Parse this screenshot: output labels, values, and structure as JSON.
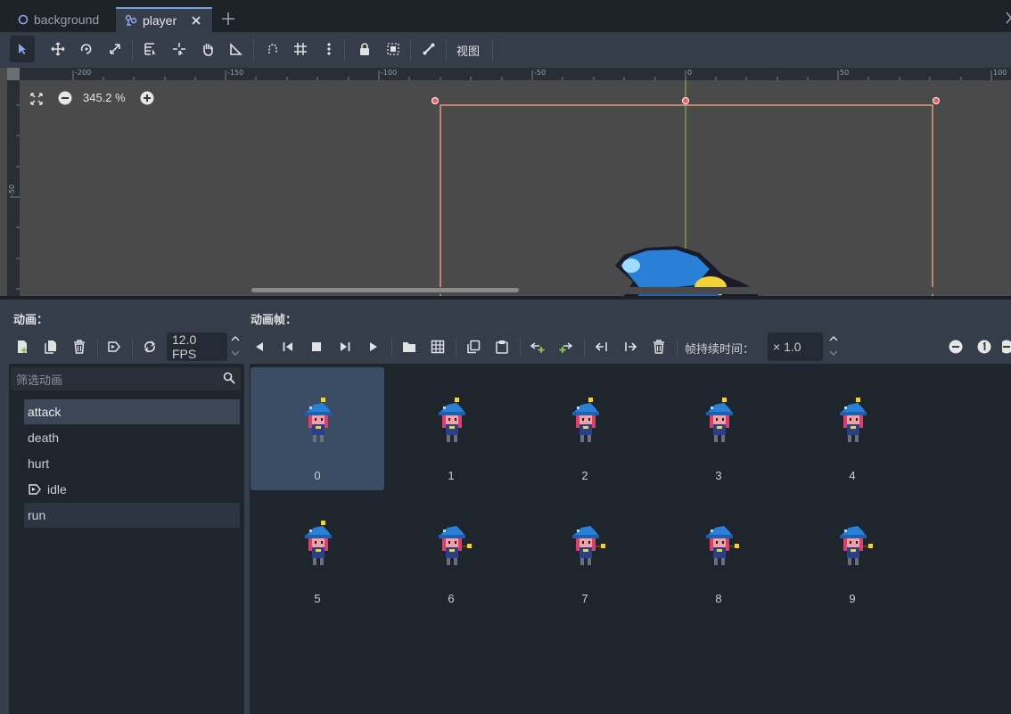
{
  "scene_tabs": [
    {
      "label": "background",
      "icon": "circle-node-icon",
      "active": false
    },
    {
      "label": "player",
      "icon": "scene-icon",
      "active": true,
      "close_icon": "close-icon"
    }
  ],
  "add_tab_icon": "plus-icon",
  "toolbar": {
    "tools": [
      "select-icon",
      "move-icon",
      "rotate-icon",
      "scale-icon",
      "list-select-icon",
      "pivot-icon",
      "pan-icon",
      "ruler-icon",
      "smart-snap-icon",
      "grid-snap-icon",
      "more-icon",
      "lock-icon",
      "group-icon",
      "bone-icon"
    ],
    "view_menu": "视图"
  },
  "viewport": {
    "zoom_label": "345.2 %",
    "ruler_h_labels": [
      "-200",
      "-150",
      "-100",
      "-50",
      "0",
      "50",
      "100"
    ],
    "ruler_v_labels": [
      "-50"
    ]
  },
  "animations_panel": {
    "title": "动画：",
    "filter_placeholder": "筛选动画",
    "items": [
      {
        "label": "attack",
        "selected": true
      },
      {
        "label": "death"
      },
      {
        "label": "hurt"
      },
      {
        "label": "idle",
        "autoplay": true
      },
      {
        "label": "run",
        "highlight": true
      }
    ]
  },
  "frames_panel": {
    "title": "动画帧：",
    "fps_value": "12.0 FPS",
    "duration_label": "帧持续时间：",
    "duration_value": "× 1.0",
    "frame_numbers": [
      "0",
      "1",
      "2",
      "3",
      "4",
      "5",
      "6",
      "7",
      "8",
      "9"
    ],
    "selected_frame": 0
  },
  "colors": {
    "accent": "#7aa0dc",
    "panel": "#363d4a",
    "selection": "#3b4d64",
    "rect_outline": "#e69a7c"
  }
}
